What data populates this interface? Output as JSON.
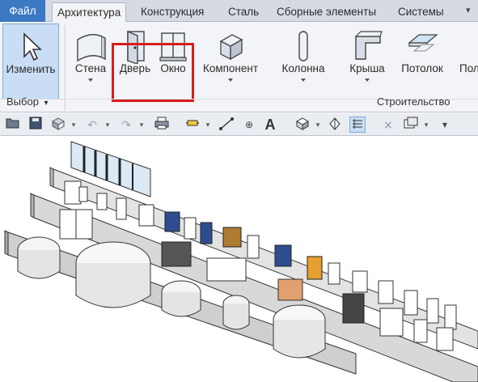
{
  "tabs": {
    "file": "Файл",
    "architecture": "Архитектура",
    "structure": "Конструкция",
    "steel": "Сталь",
    "precast": "Сборные элементы",
    "systems": "Системы"
  },
  "ribbon": {
    "modify": "Изменить",
    "wall": "Стена",
    "door": "Дверь",
    "window": "Окно",
    "component": "Компонент",
    "column": "Колонна",
    "roof": "Крыша",
    "ceiling": "Потолок",
    "floor_partial": "Пол",
    "select_panel": "Выбор",
    "build_panel": "Строительство"
  },
  "colors": {
    "file_tab": "#3b78c2",
    "highlight": "#d91c1c",
    "modify_bg": "#c9def5",
    "ribbon_bg": "#f3f4f7"
  },
  "qat_icons": [
    "open-icon",
    "save-icon",
    "sync-icon",
    "undo-icon",
    "redo-icon",
    "print-icon",
    "measure-icon",
    "dimension-icon",
    "tag-icon",
    "text-icon",
    "3d-view-icon",
    "section-icon",
    "thin-lines-icon",
    "close-hidden-icon",
    "switch-windows-icon",
    "customize-icon"
  ]
}
